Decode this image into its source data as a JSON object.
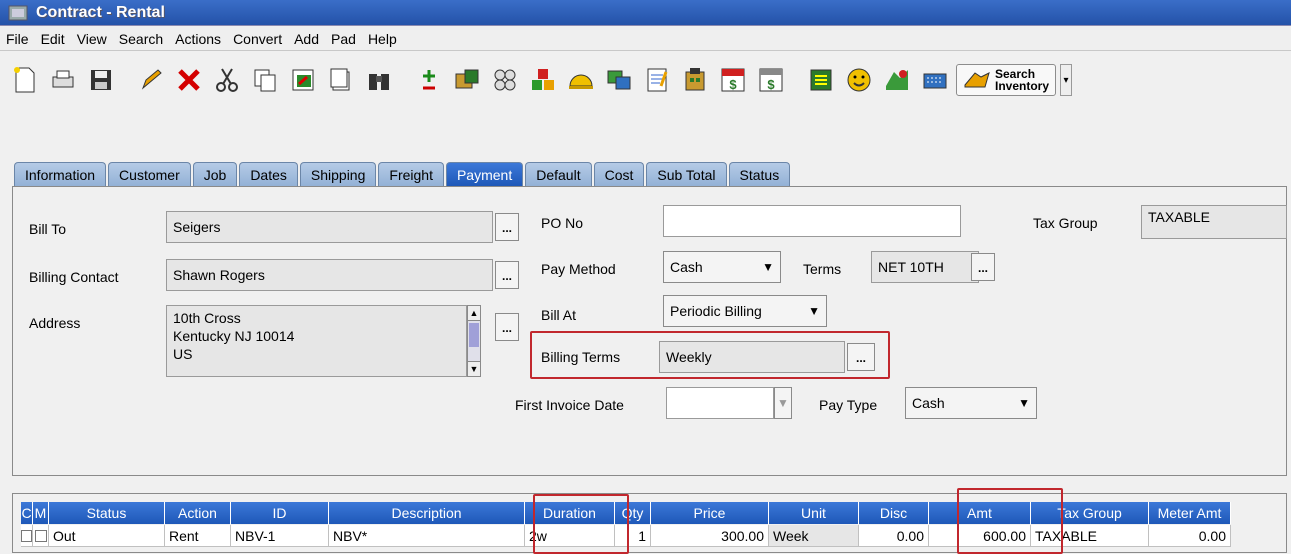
{
  "window": {
    "title": "Contract - Rental"
  },
  "menu": [
    "File",
    "Edit",
    "View",
    "Search",
    "Actions",
    "Convert",
    "Add",
    "Pad",
    "Help"
  ],
  "toolbar": {
    "icons": [
      "new-document-icon",
      "print-icon",
      "save-icon",
      "edit-pencil-icon",
      "delete-x-icon",
      "cut-scissors-icon",
      "copy-icon",
      "paste-icon",
      "copy-document-icon",
      "find-binoculars-icon",
      "add-line-icon",
      "crate-icon",
      "options-icon",
      "inventory-blocks-icon",
      "helmet-icon",
      "transfer-icon",
      "notepad-icon",
      "building-icon",
      "pay-icon",
      "due-icon",
      "report-icon",
      "smiley-icon",
      "map-icon",
      "keyboard-icon"
    ],
    "search_inventory_line1": "Search",
    "search_inventory_line2": "Inventory",
    "overflow_glyph": "▾"
  },
  "tabs": [
    "Information",
    "Customer",
    "Job",
    "Dates",
    "Shipping",
    "Freight",
    "Payment",
    "Default",
    "Cost",
    "Sub Total",
    "Status"
  ],
  "active_tab": "Payment",
  "form": {
    "bill_to_label": "Bill To",
    "bill_to_value": "Seigers",
    "billing_contact_label": "Billing Contact",
    "billing_contact_value": "Shawn  Rogers",
    "address_label": "Address",
    "address_line1": "10th Cross",
    "address_line2": "Kentucky NJ 10014",
    "address_line3": "US",
    "po_no_label": "PO No",
    "po_no_value": "",
    "pay_method_label": "Pay Method",
    "pay_method_value": "Cash",
    "terms_label": "Terms",
    "terms_value": "NET 10TH",
    "bill_at_label": "Bill At",
    "bill_at_value": "Periodic Billing",
    "billing_terms_label": "Billing Terms",
    "billing_terms_value": "Weekly",
    "first_invoice_date_label": "First Invoice Date",
    "first_invoice_date_value": "",
    "pay_type_label": "Pay Type",
    "pay_type_value": "Cash",
    "tax_group_label": "Tax Group",
    "tax_group_value": "TAXABLE",
    "ellipsis": "..."
  },
  "grid": {
    "headers": [
      "C",
      "M",
      "Status",
      "Action",
      "ID",
      "Description",
      "Duration",
      "Qty",
      "Price",
      "Unit",
      "Disc",
      "Amt",
      "Tax Group",
      "Meter Amt"
    ],
    "row": {
      "status": "Out",
      "action": "Rent",
      "id": "NBV-1",
      "description": "NBV*",
      "duration": "2w",
      "qty": "1",
      "price": "300.00",
      "unit": "Week",
      "disc": "0.00",
      "amt": "600.00",
      "tax_group": "TAXABLE",
      "meter_amt": "0.00"
    }
  },
  "colors": {
    "tab": "#93b1d6",
    "tab_active": "#1e58b8",
    "highlight": "#c1272d"
  }
}
